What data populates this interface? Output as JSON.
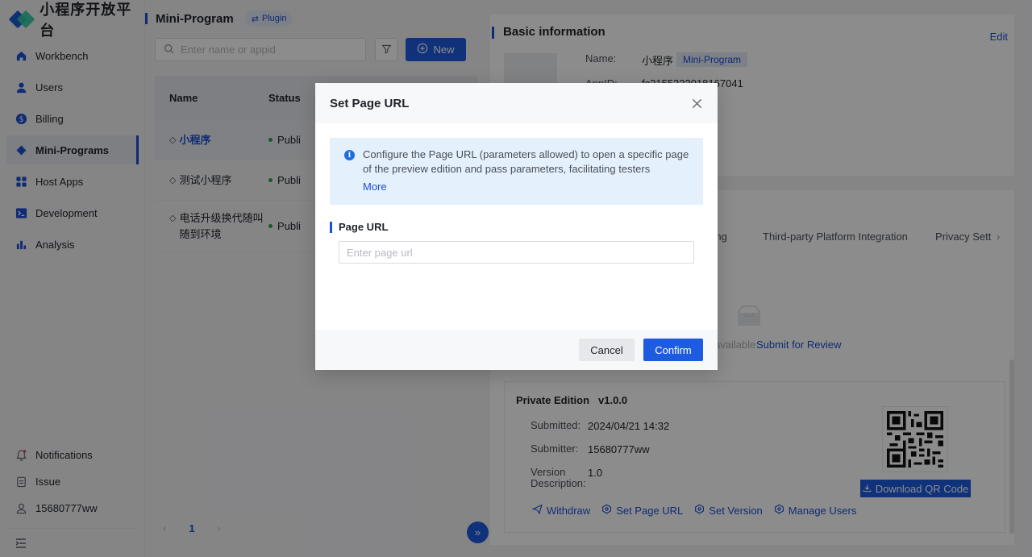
{
  "brand": {
    "name": "小程序开放平台",
    "accent": "#1d4fd6"
  },
  "sidebar": {
    "items": [
      {
        "label": "Workbench",
        "icon": "home-icon"
      },
      {
        "label": "Users",
        "icon": "user-icon"
      },
      {
        "label": "Billing",
        "icon": "billing-icon"
      },
      {
        "label": "Mini-Programs",
        "icon": "mini-program-icon",
        "active": true
      },
      {
        "label": "Host Apps",
        "icon": "apps-grid-icon"
      },
      {
        "label": "Development",
        "icon": "terminal-icon"
      },
      {
        "label": "Analysis",
        "icon": "bar-chart-icon"
      }
    ],
    "bottom": [
      {
        "label": "Notifications",
        "icon": "bell-icon"
      },
      {
        "label": "Issue",
        "icon": "clipboard-icon"
      },
      {
        "label": "15680777ww",
        "icon": "user-outline-icon"
      }
    ]
  },
  "list": {
    "title": "Mini-Program",
    "plugin_tag": "Plugin",
    "search_placeholder": "Enter name or appid",
    "new_label": "New",
    "columns": [
      "Name",
      "Status"
    ],
    "rows": [
      {
        "name": "小程序",
        "status": "Publi"
      },
      {
        "name": "测试小程序",
        "status": "Publi"
      },
      {
        "name": "电话升级换代随叫随到环境",
        "status": "Publi"
      }
    ],
    "page": "1"
  },
  "detail": {
    "section_title": "Basic information",
    "edit_label": "Edit",
    "name_label": "Name:",
    "name_value": "小程序",
    "name_tag": "Mini-Program",
    "appid_label": "AppID:",
    "appid_value": "fc2155222018167041",
    "tabs": [
      "nding",
      "Third-party Platform Integration",
      "Privacy Sett"
    ],
    "avail_text": "available",
    "submit_review": "Submit for Review",
    "edition_title": "Private Edition",
    "edition_version": "v1.0.0",
    "submitted_label": "Submitted:",
    "submitted_value": "2024/04/21 14:32",
    "submitter_label": "Submitter:",
    "submitter_value": "15680777ww",
    "version_desc_label": "Version Description:",
    "version_desc_value": "1.0",
    "download_qr": "Download QR Code",
    "actions": [
      "Withdraw",
      "Set Page URL",
      "Set Version",
      "Manage Users"
    ]
  },
  "modal": {
    "title": "Set Page URL",
    "info_text": "Configure the Page URL (parameters allowed) to open a specific page of the preview edition and pass parameters, facilitating testers",
    "more_label": "More",
    "field_label": "Page URL",
    "input_placeholder": "Enter page url",
    "input_value": "",
    "cancel_label": "Cancel",
    "confirm_label": "Confirm"
  }
}
